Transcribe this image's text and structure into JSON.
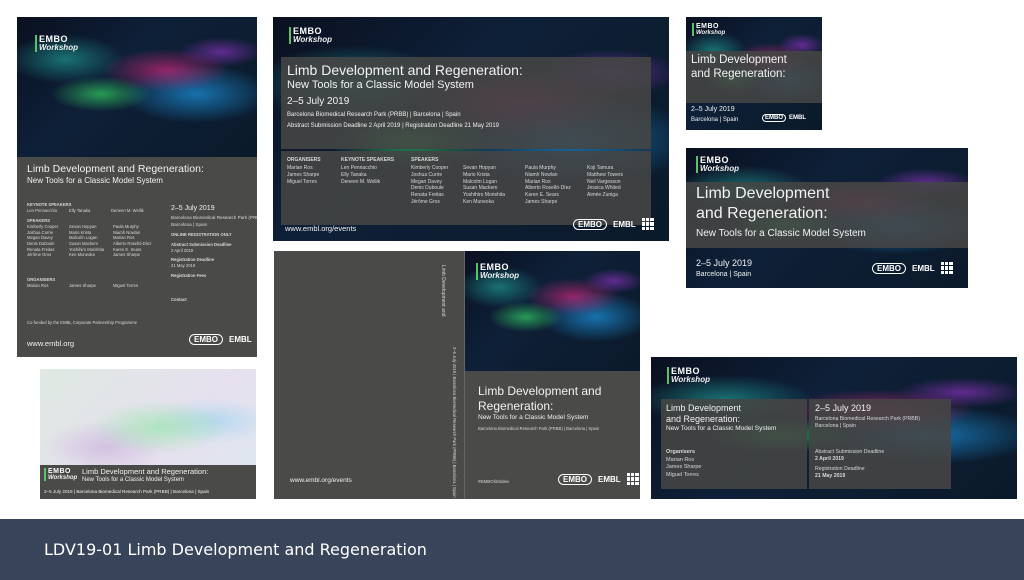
{
  "brand": {
    "embo": "EMBO",
    "workshop": "Workshop",
    "embo_badge": "EMBO",
    "embl": "EMBL"
  },
  "event": {
    "title_line1": "Limb Development and Regeneration:",
    "subtitle": "New Tools for a Classic Model System",
    "dates": "2–5 July 2019",
    "location_short": "Barcelona | Spain",
    "venue_line": "Barcelona Biomedical Research Park (PRBB) | Barcelona | Spain",
    "venue": "Barcelona Biomedical Research Park (PRBB)",
    "deadlines_line": "Abstract Submission Deadline 2 April 2019 | Registration Deadline 21 May 2019",
    "website": "www.embl.org/events",
    "website_short": "www.embl.org",
    "hashtag": "#EMBOlimbdev",
    "strip_line": "2–5 July 2019 | Barcelona Biomedical Research Park (PRBB) | Barcelona | Spain",
    "spine_line": "2–5 July 2019 | Barcelona Biomedical Research Park (PRBB) | Barcelona | Spain"
  },
  "title_split": {
    "limb": "Limb Development",
    "and_regen": "and Regeneration:",
    "limb_dev_and": "Limb Development and",
    "regeneration": "Regeneration:"
  },
  "people": {
    "organisers_label": "ORGANISERS",
    "organisers_label_title": "Organisers",
    "organisers": [
      "Marian Ros",
      "James Sharpe",
      "Miguel Torres"
    ],
    "keynote_label": "KEYNOTE SPEAKERS",
    "keynotes": [
      "Len Pennacchio",
      "Elly Tanaka",
      "Deneen M. Wellik"
    ],
    "speakers_label": "SPEAKERS",
    "speakers_col1": [
      "Kimberly Cooper",
      "Joshua Currie",
      "Megan Davey",
      "Denis Duboule",
      "Renata Freitas",
      "Jérôme Gros"
    ],
    "speakers_col2": [
      "Sevan Hopyan",
      "Mario Krista",
      "Malcolm Logan",
      "Susan Mackem",
      "Yoshihiro Morishita",
      "Ken Muneoka"
    ],
    "speakers_col3": [
      "Paula Murphy",
      "Niamh Nowlan",
      "Marian Ros",
      "Alberto Roselló-Díez",
      "Karen E. Sears",
      "James Sharpe"
    ],
    "speakers_col4": [
      "Koji Tamura",
      "Matthew Towers",
      "Neil Vargesson",
      "Jessica Whited",
      "Aimée Zuniga"
    ]
  },
  "poster": {
    "online_reg": "ONLINE REGISTRATION ONLY",
    "abstract_label": "Abstract Submission Deadline",
    "abstract_date": "2 April 2019",
    "reg_label": "Registration Deadline",
    "reg_date": "21 May 2019",
    "fees_label": "Registration Fees",
    "contact_label": "Contact",
    "cofunded": "Co-funded by the EMBL Corporate Partnership Programme"
  },
  "banner": {
    "abstract_label": "Abstract Submission Deadline",
    "abstract_date": "2 April 2019",
    "reg_label": "Registration Deadline",
    "reg_date": "21 May 2019"
  },
  "footer": {
    "title": "LDV19-01 Limb Development and Regeneration"
  }
}
